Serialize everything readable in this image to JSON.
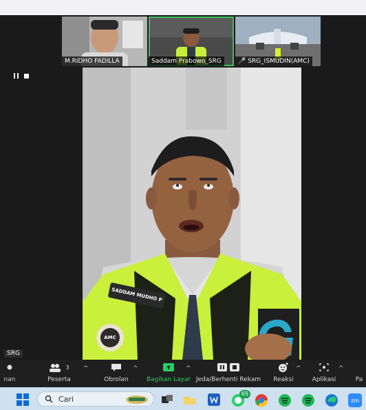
{
  "participants": [
    {
      "name": "M.RIDHO FADILLA",
      "muted": false
    },
    {
      "name": "Saddam Prabowo_SRG",
      "muted": false,
      "active": true
    },
    {
      "name": "SRG_ISMUDIN(AMC)",
      "muted": true
    }
  ],
  "main_speaker": {
    "vest_text": "SADDAM MUDHO P",
    "logo_text": "AMC"
  },
  "name_chip": "SRG",
  "toolbar": {
    "left_cut_label": "nan",
    "participants_label": "Peserta",
    "participants_count": "3",
    "chat_label": "Obrolan",
    "share_label": "Bagikan Layar",
    "record_label": "Jeda/Berhenti Rekam",
    "reactions_label": "Reaksi",
    "apps_label": "Aplikasi",
    "right_cut_label": "Pa"
  },
  "taskbar": {
    "search_placeholder": "Cari",
    "whatsapp_badge": "65"
  },
  "colors": {
    "share_green": "#23d160",
    "active_border": "#38c35b",
    "vest_yellow": "#c9f03a"
  }
}
